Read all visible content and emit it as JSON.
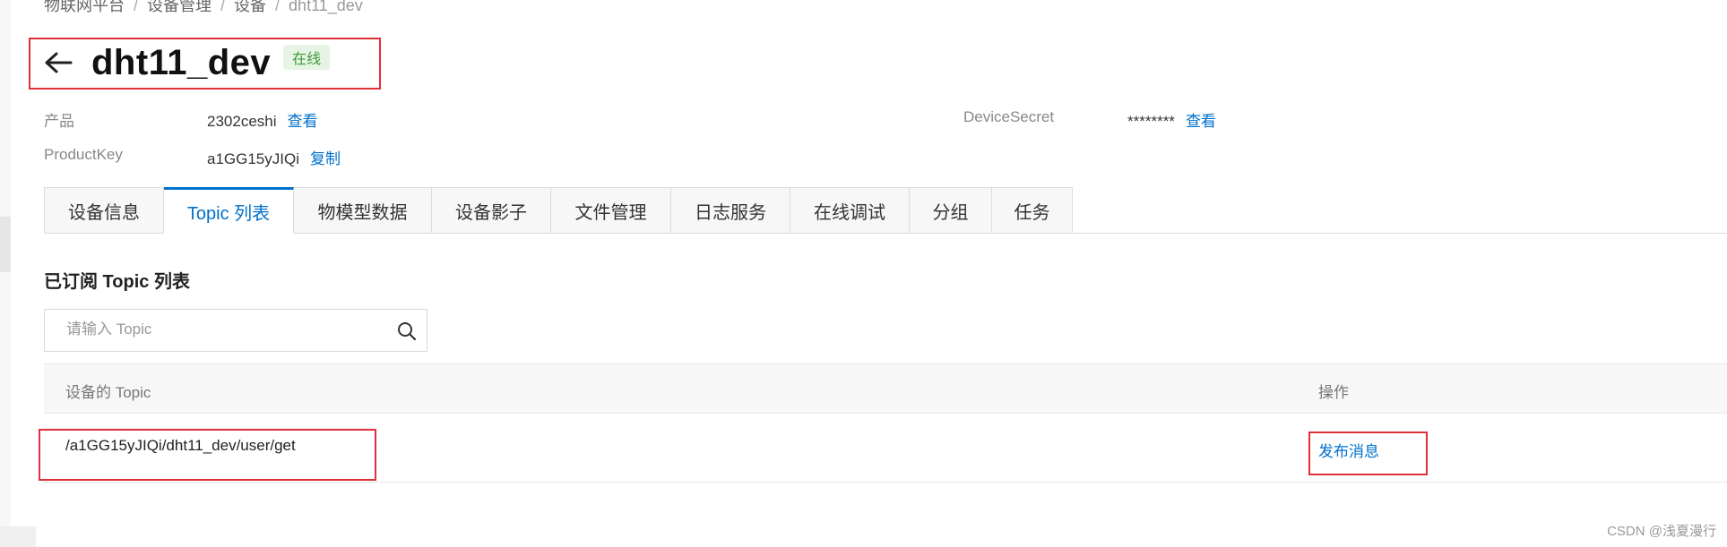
{
  "breadcrumb": {
    "items": [
      "物联网平台",
      "设备管理",
      "设备"
    ],
    "current": "dht11_dev"
  },
  "header": {
    "title": "dht11_dev",
    "status": "在线"
  },
  "meta": {
    "product_label": "产品",
    "product_value": "2302ceshi",
    "product_link": "查看",
    "productkey_label": "ProductKey",
    "productkey_value": "a1GG15yJIQi",
    "productkey_link": "复制",
    "secret_label": "DeviceSecret",
    "secret_value": "********",
    "secret_link": "查看"
  },
  "tabs": [
    {
      "label": "设备信息"
    },
    {
      "label": "Topic 列表"
    },
    {
      "label": "物模型数据"
    },
    {
      "label": "设备影子"
    },
    {
      "label": "文件管理"
    },
    {
      "label": "日志服务"
    },
    {
      "label": "在线调试"
    },
    {
      "label": "分组"
    },
    {
      "label": "任务"
    }
  ],
  "active_tab": "Topic 列表",
  "section": {
    "title": "已订阅 Topic 列表"
  },
  "search": {
    "placeholder": "请输入 Topic",
    "value": ""
  },
  "table": {
    "columns": [
      "设备的 Topic",
      "操作"
    ],
    "rows": [
      {
        "topic": "/a1GG15yJIQi/dht11_dev/user/get",
        "action": "发布消息"
      }
    ]
  },
  "watermark": "CSDN @浅夏漫行",
  "colors": {
    "accent": "#0070cc",
    "status_bg": "#e6f4e3",
    "status_text": "#3f9a3a",
    "highlight": "#e0303a"
  },
  "icons": {
    "back": "arrow-left-icon",
    "search": "search-icon"
  }
}
